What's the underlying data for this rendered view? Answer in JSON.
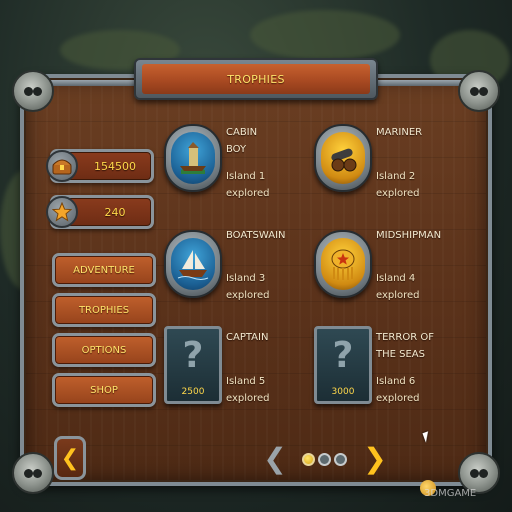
{
  "title": "TROPHIES",
  "stats": {
    "gold": "154500",
    "stars": "240"
  },
  "menu": [
    {
      "label": "ADVENTURE"
    },
    {
      "label": "TROPHIES"
    },
    {
      "label": "OPTIONS"
    },
    {
      "label": "SHOP"
    }
  ],
  "trophies": [
    {
      "name_line1": "CABIN",
      "name_line2": "BOY",
      "desc_line1": "Island 1",
      "desc_line2": "explored",
      "icon": "ship-on-island-icon",
      "state": "unlocked"
    },
    {
      "name_line1": "MARINER",
      "name_line2": "",
      "desc_line1": "Island 2",
      "desc_line2": "explored",
      "icon": "cannon-icon",
      "state": "unlocked"
    },
    {
      "name_line1": "BOATSWAIN",
      "name_line2": "",
      "desc_line1": "Island 3",
      "desc_line2": "explored",
      "icon": "sailing-ship-icon",
      "state": "unlocked"
    },
    {
      "name_line1": "MIDSHIPMAN",
      "name_line2": "",
      "desc_line1": "Island 4",
      "desc_line2": "explored",
      "icon": "epaulette-icon",
      "state": "unlocked"
    },
    {
      "name_line1": "CAPTAIN",
      "name_line2": "",
      "desc_line1": "Island 5",
      "desc_line2": "explored",
      "icon": "question-mark-icon",
      "state": "locked",
      "cost": "2500"
    },
    {
      "name_line1": "TERROR OF",
      "name_line2": "THE SEAS",
      "desc_line1": "Island 6",
      "desc_line2": "explored",
      "icon": "question-mark-icon",
      "state": "locked",
      "cost": "3000"
    }
  ],
  "pager": {
    "current_page": 1,
    "total_pages": 3
  },
  "watermark": "3DMGAME",
  "colors": {
    "accent_text": "#ffe36a",
    "wood": "#5c331b",
    "frame": "#7f8b93",
    "nav_arrow_active": "#ffc21e",
    "nav_arrow_inactive": "#9aa3a9"
  }
}
